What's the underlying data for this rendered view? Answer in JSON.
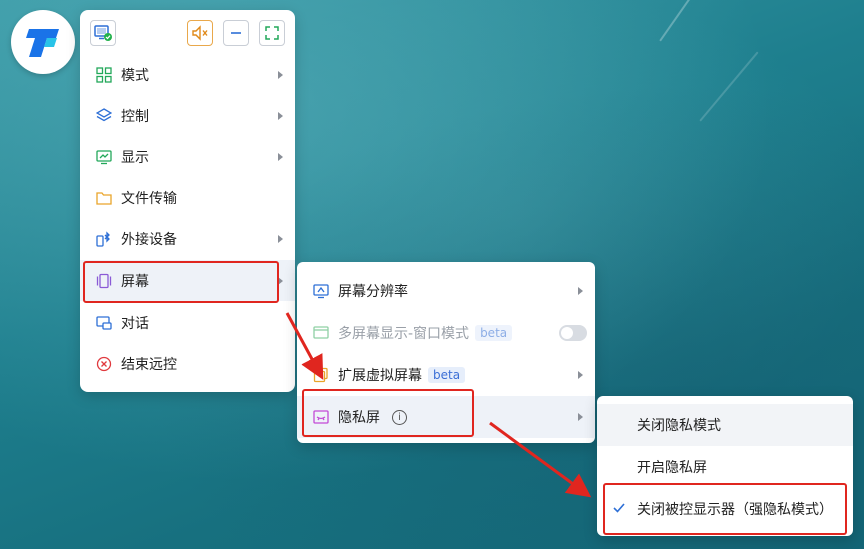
{
  "panel": {
    "items": [
      {
        "label": "模式",
        "has_sub": true
      },
      {
        "label": "控制",
        "has_sub": true
      },
      {
        "label": "显示",
        "has_sub": true
      },
      {
        "label": "文件传输",
        "has_sub": false
      },
      {
        "label": "外接设备",
        "has_sub": true
      },
      {
        "label": "屏幕",
        "has_sub": true
      },
      {
        "label": "对话",
        "has_sub": false
      },
      {
        "label": "结束远控",
        "has_sub": false
      }
    ]
  },
  "screen_submenu": {
    "items": [
      {
        "label": "屏幕分辨率"
      },
      {
        "label": "多屏幕显示-窗口模式",
        "badge": "beta",
        "toggle": "off",
        "disabled": true
      },
      {
        "label": "扩展虚拟屏幕",
        "badge": "beta"
      },
      {
        "label": "隐私屏",
        "info_icon": "i"
      }
    ]
  },
  "privacy_submenu": {
    "options": [
      {
        "label": "关闭隐私模式"
      },
      {
        "label": "开启隐私屏"
      },
      {
        "label": "关闭被控显示器（强隐私模式）",
        "checked": true
      }
    ]
  },
  "colors": {
    "highlight": "#e0261f",
    "accent": "#3b6fd6",
    "logo_blue": "#1a73e8",
    "logo_cyan": "#29c3e8"
  }
}
